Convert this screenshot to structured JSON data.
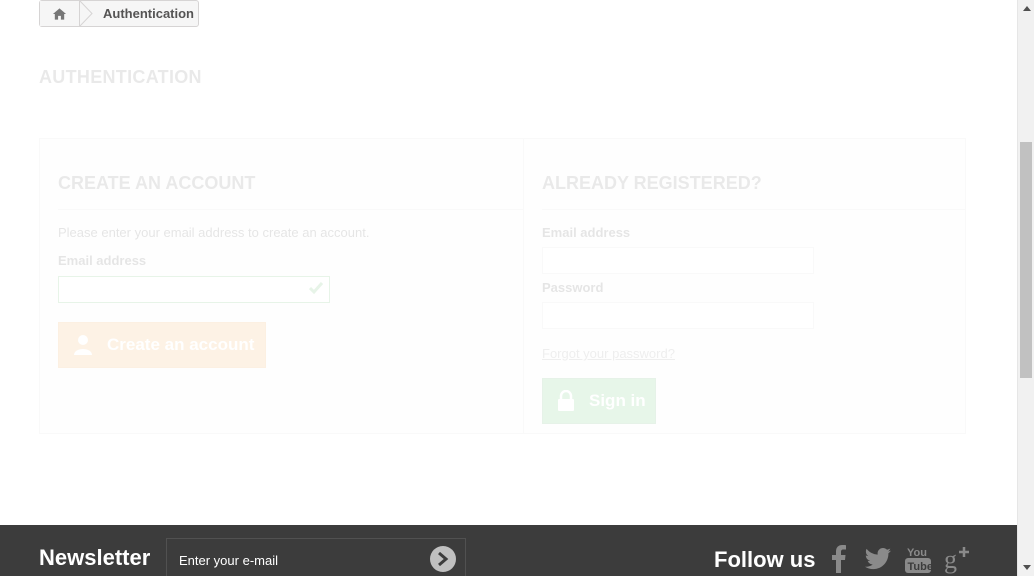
{
  "breadcrumb": {
    "current": "Authentication"
  },
  "page": {
    "heading": "AUTHENTICATION"
  },
  "create_account": {
    "title": "CREATE AN ACCOUNT",
    "instruction": "Please enter your email address to create an account.",
    "email_label": "Email address",
    "email_value": "",
    "button_label": "Create an account"
  },
  "login": {
    "title": "ALREADY REGISTERED?",
    "email_label": "Email address",
    "email_value": "",
    "password_label": "Password",
    "password_value": "",
    "forgot_label": "Forgot your password?",
    "button_label": "Sign in"
  },
  "footer": {
    "newsletter_title": "Newsletter",
    "newsletter_value": "Enter your e-mail",
    "follow_title": "Follow us",
    "social": [
      "facebook-icon",
      "twitter-icon",
      "youtube-icon",
      "google-plus-icon"
    ]
  },
  "colors": {
    "create_button": "#f39d32",
    "signin_button": "#43b754",
    "footer_bg": "#3c3c3c"
  }
}
